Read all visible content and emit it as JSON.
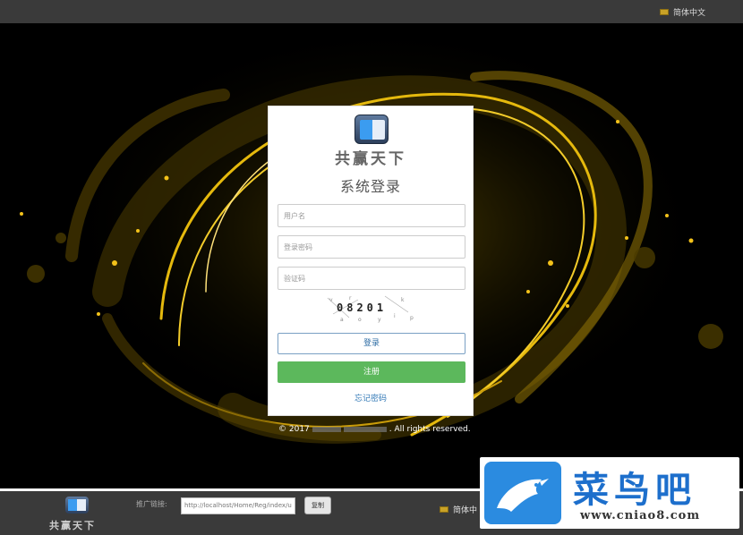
{
  "header": {
    "language": "简体中文"
  },
  "login": {
    "brand": "共赢天下",
    "title": "系统登录",
    "username_placeholder": "用户名",
    "password_placeholder": "登录密码",
    "captcha_placeholder": "验证码",
    "captcha_text": "08201",
    "login_label": "登录",
    "register_label": "注册",
    "forgot_label": "忘记密码"
  },
  "footer": {
    "copyright_prefix": "© 2017",
    "copyright_suffix": ". All rights reserved."
  },
  "bottom": {
    "brand": "共赢天下",
    "promo_label": "推广链接:",
    "promo_url": "http://localhost/Home/Reg/index/u",
    "copy_label": "复制",
    "language": "简体中"
  },
  "watermark": {
    "title": "菜鸟吧",
    "url": "www.cniao8.com"
  },
  "colors": {
    "register": "#5cb85c",
    "link": "#337ab7",
    "bar": "#3a3a3a",
    "swirl": "#e5b90d"
  }
}
